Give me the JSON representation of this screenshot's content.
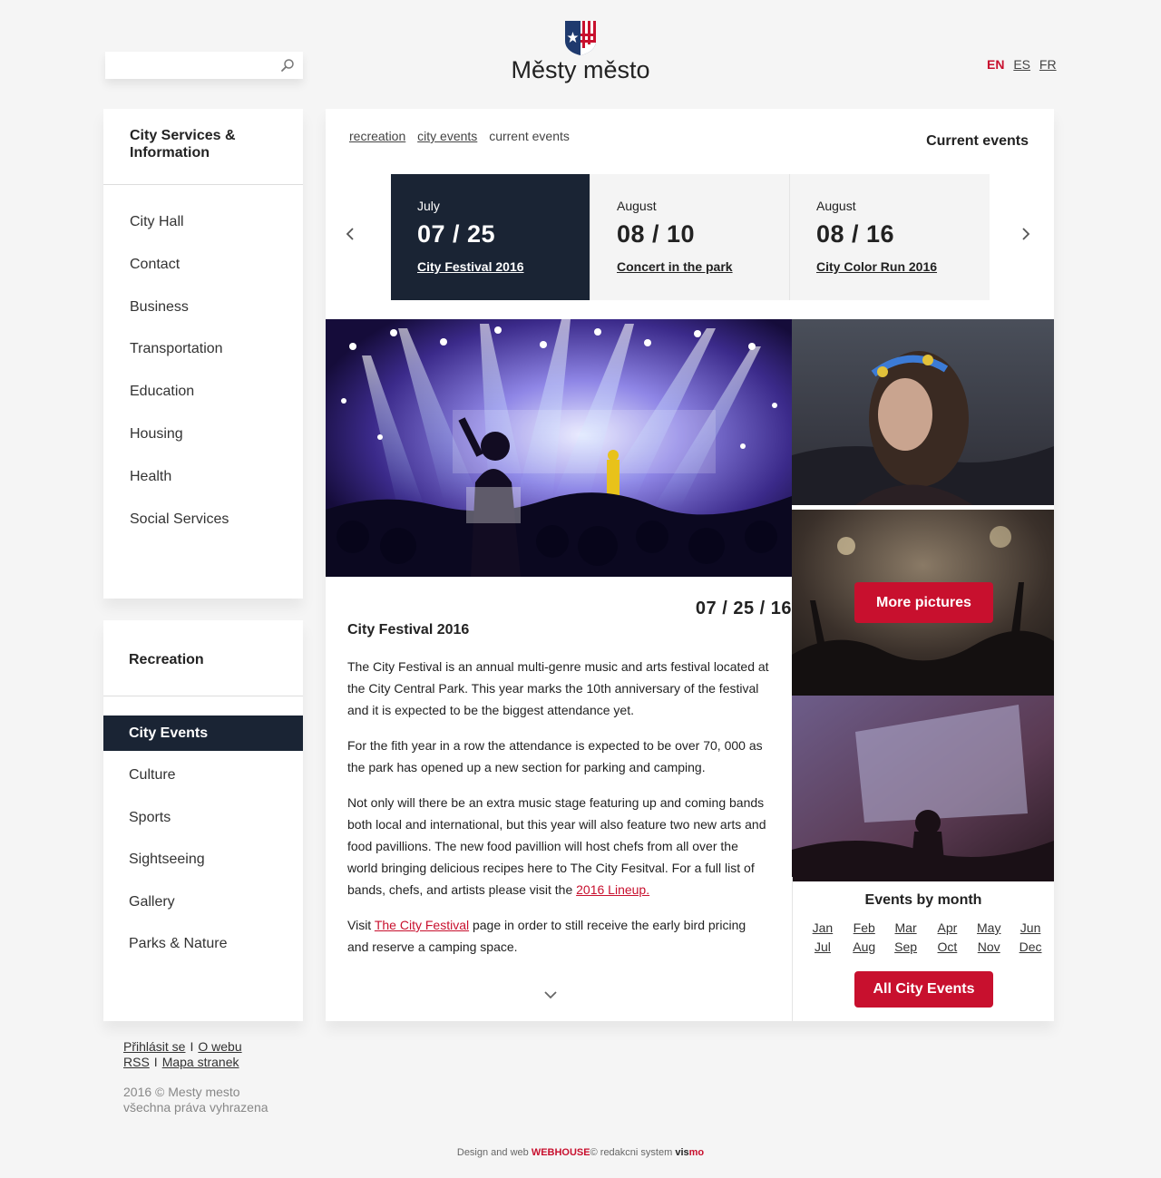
{
  "header": {
    "site_title": "Městy město",
    "search_placeholder": "",
    "languages": [
      {
        "code": "EN",
        "active": true
      },
      {
        "code": "ES",
        "active": false
      },
      {
        "code": "FR",
        "active": false
      }
    ]
  },
  "sidebar": {
    "services_title": "City Services & Information",
    "services_items": [
      "City Hall",
      "Contact",
      "Business",
      "Transportation",
      "Education",
      "Housing",
      "Health",
      "Social Services"
    ],
    "recreation_title": "Recreation",
    "recreation_items": [
      "City Events",
      "Culture",
      "Sports",
      "Sightseeing",
      "Gallery",
      "Parks & Nature"
    ],
    "recreation_active": "City Events"
  },
  "footer": {
    "links_row1": [
      "Přihlásit se",
      "O webu"
    ],
    "links_row2": [
      "RSS",
      "Mapa stranek"
    ],
    "separator": "I",
    "copyright_line1": "2016 © Mesty mesto",
    "copyright_line2": "všechna práva vyhrazena",
    "credits_prefix": "Design and web",
    "credits_brand": "WEBHOUSE",
    "credits_brand_suffix": "©",
    "credits_mid": "redakcni system",
    "credits_vis": "vis",
    "credits_mo": "mo"
  },
  "main": {
    "breadcrumb": {
      "link1": "recreation",
      "link2": "city events",
      "current": "current events"
    },
    "heading": "Current events",
    "events": [
      {
        "month": "July",
        "date": "07 / 25",
        "name": "City Festival 2016",
        "active": true
      },
      {
        "month": "August",
        "date": "08 / 10",
        "name": "Concert in the park",
        "active": false
      },
      {
        "month": "August",
        "date": "08 / 16",
        "name": "City Color Run 2016",
        "active": false
      }
    ],
    "more_pictures_label": "More pictures",
    "article": {
      "date": "07 / 25 / 16",
      "title": "City Festival 2016",
      "p1": "The City Festival is an annual multi-genre music and arts festival located at the City Central Park. This year marks the 10th anniversary of the festival and it is expected to be the biggest attendance yet.",
      "p2": "For the fith year in a row the attendance is expected to be over 70, 000 as the park has opened up a new section for parking and camping.",
      "p3_text": "Not only will there be an extra music stage featuring up and coming bands both local and international, but this year will also feature two new arts and food pavillions. The new food pavillion will host chefs from all over the world bringing delicious recipes here to The City Fesitval. For a full list of bands, chefs, and artists please visit the",
      "p3_link": "2016 Lineup.",
      "p4_pre": "Visit",
      "p4_link": "The City Festival",
      "p4_post": "page in order to still receive the early bird pricing and reserve a camping space."
    },
    "events_by_month": {
      "title": "Events by month",
      "months": [
        "Jan",
        "Feb",
        "Mar",
        "Apr",
        "May",
        "Jun",
        "Jul",
        "Aug",
        "Sep",
        "Oct",
        "Nov",
        "Dec"
      ],
      "all_button": "All City Events"
    }
  },
  "colors": {
    "accent": "#c8102e",
    "navy": "#1a2434",
    "background": "#f5f5f5"
  }
}
